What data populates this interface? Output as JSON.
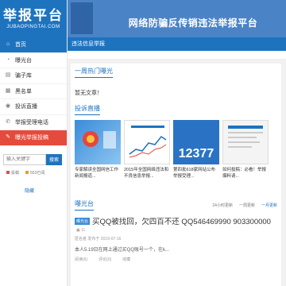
{
  "logo": {
    "title": "举报平台",
    "subtitle": "JUBAOPINGTAI.COM"
  },
  "nav": [
    {
      "label": "首页",
      "icon": "home-icon",
      "active": true
    },
    {
      "label": "曝光台",
      "icon": "speaker-icon"
    },
    {
      "label": "骗子库",
      "icon": "book-icon"
    },
    {
      "label": "黑名单",
      "icon": "grid-icon"
    },
    {
      "label": "投诉直播",
      "icon": "broadcast-icon"
    },
    {
      "label": "举报受理电话",
      "icon": "phone-icon"
    },
    {
      "label": "曝光举报投稿",
      "icon": "edit-icon",
      "highlight": true
    }
  ],
  "search": {
    "placeholder": "输入关键字",
    "button": "搜索"
  },
  "badges": [
    "投稿",
    "553已阅"
  ],
  "collapse_label": "隐藏",
  "banner": {
    "text": "网络防骗反传销违法举报平台"
  },
  "strip": {
    "text": "违法信息举报"
  },
  "hot": {
    "title": "一周热门曝光",
    "empty": "暂无文章！"
  },
  "live": {
    "title": "投诉直播",
    "items": [
      {
        "caption": "专家解读全国网信工作新闻报道..."
      },
      {
        "caption": "2015年全国网络违法和不良信息举报..."
      },
      {
        "caption": "第四批618家网站公布举报受理...",
        "number": "12377"
      },
      {
        "caption": "如何投稿：必看！举报爆料请..."
      }
    ]
  },
  "exposure": {
    "title": "曝光台",
    "tabs": [
      "24小时更新",
      "一周更新",
      "一月更新"
    ],
    "item": {
      "tag": "曝光台",
      "title": "买QQ被找回，欠四百不还 QQ546469990 903300000",
      "count": "11",
      "meta": "匿名者 发布于 2019-07-16",
      "excerpt": "本人5.19日在网上通过买QQ账号一个，在k...",
      "actions": [
        "阅读(6)",
        "评论(0)",
        "收藏"
      ]
    }
  }
}
